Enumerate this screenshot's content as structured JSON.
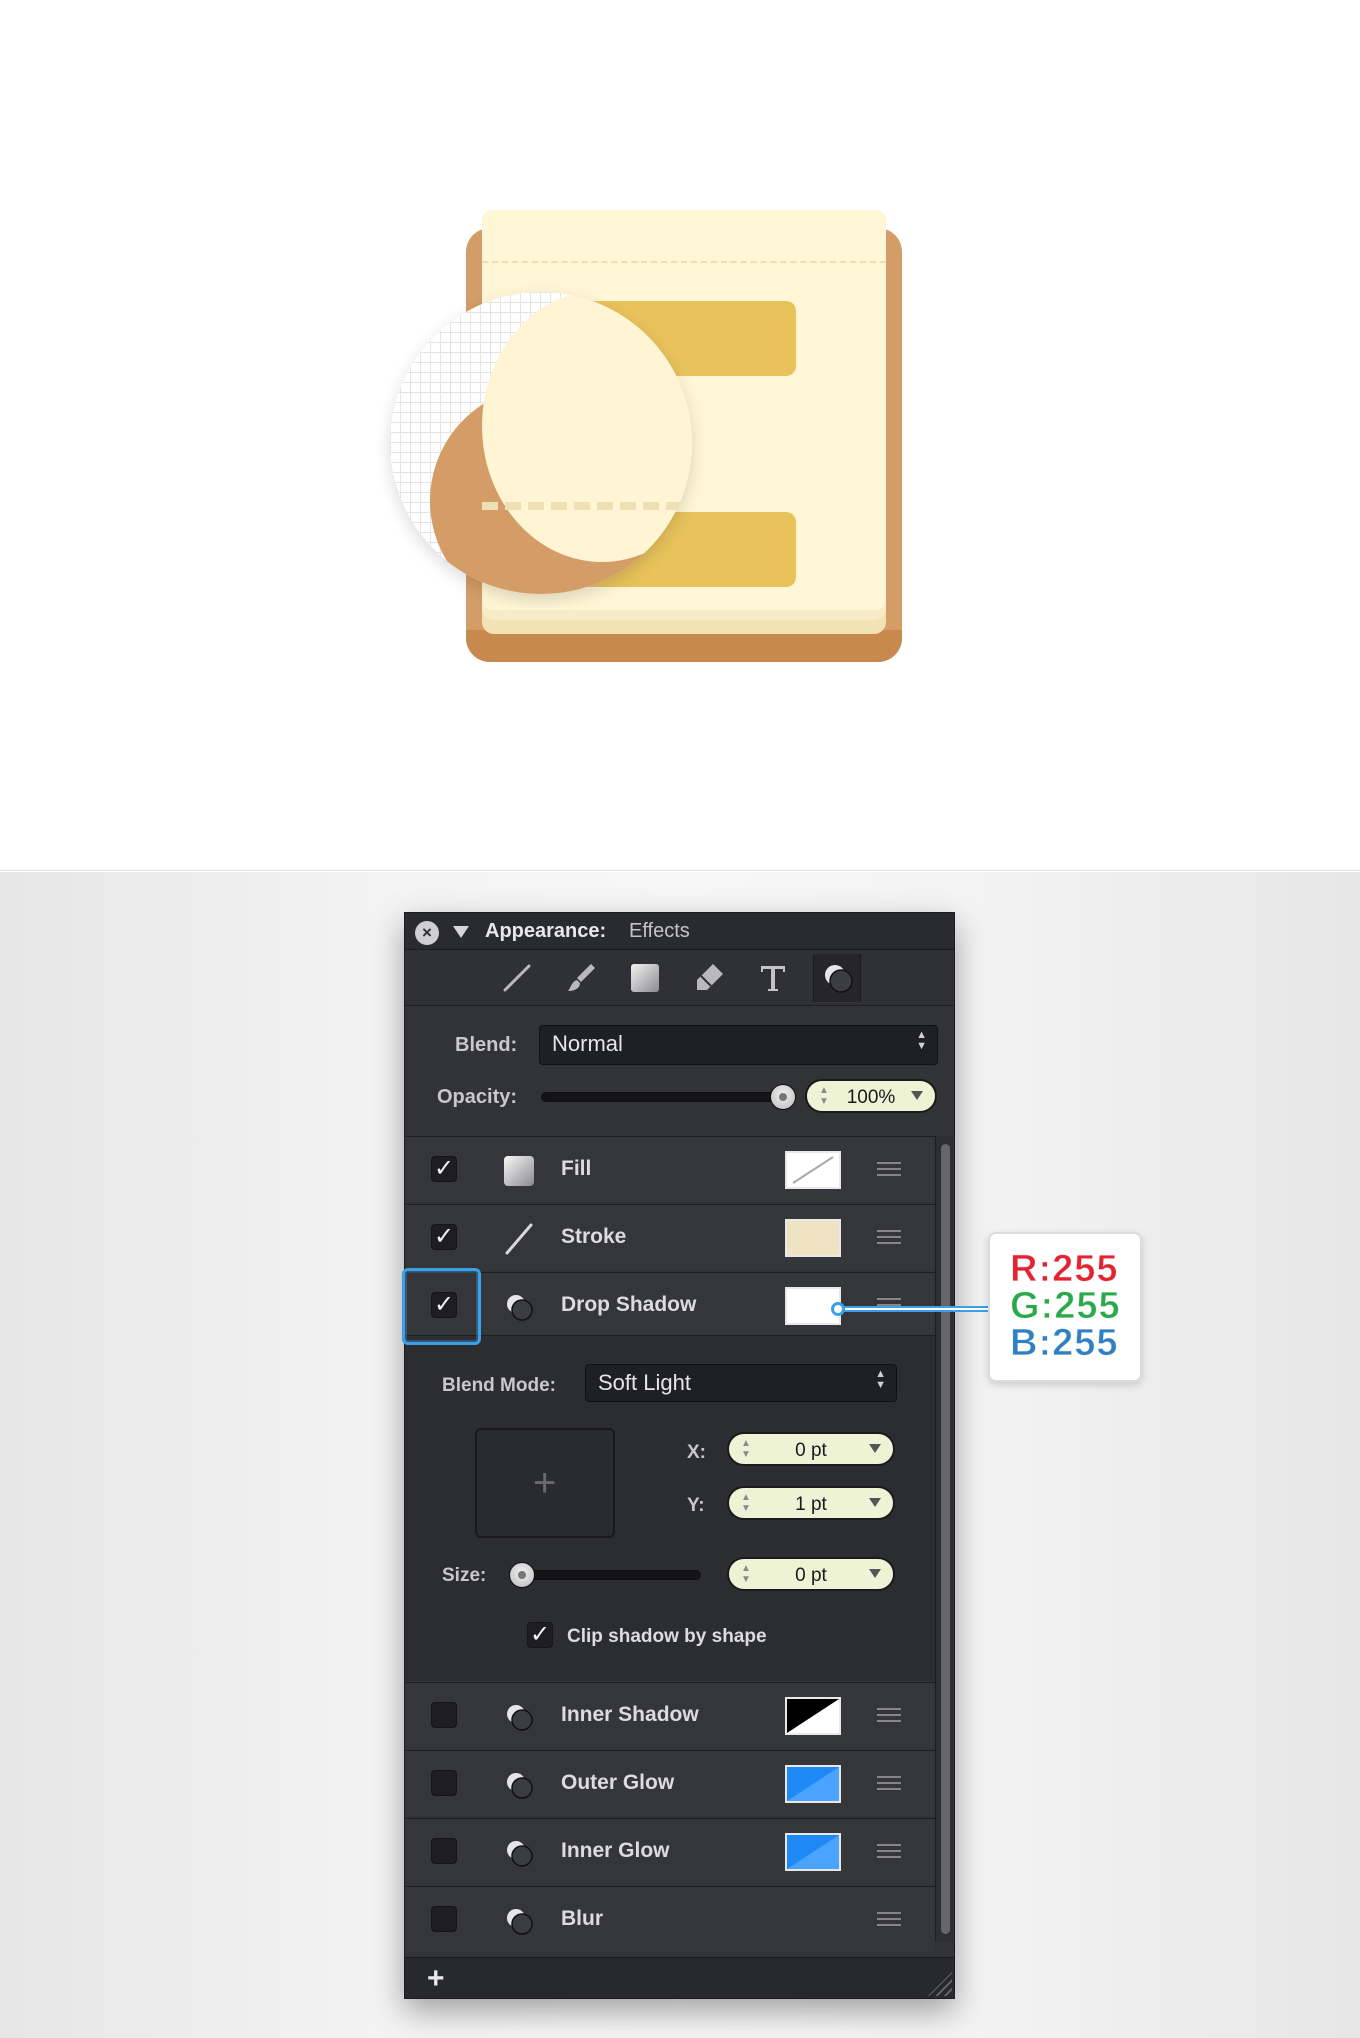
{
  "panel": {
    "title_label": "Appearance:",
    "title_value": "Effects",
    "tools": [
      {
        "icon": "line-tool-icon"
      },
      {
        "icon": "brush-tool-icon"
      },
      {
        "icon": "square-fill-icon"
      },
      {
        "icon": "eraser-tool-icon"
      },
      {
        "icon": "text-tool-icon"
      },
      {
        "icon": "effects-icon",
        "active": true
      }
    ],
    "blend_label": "Blend:",
    "blend_value": "Normal",
    "opacity_label": "Opacity:",
    "opacity_value": "100%",
    "opacity_level": 1.0,
    "effects": [
      {
        "label": "Fill",
        "checked": true,
        "icon": "fill-icon",
        "swatch": "none"
      },
      {
        "label": "Stroke",
        "checked": true,
        "icon": "stroke-icon",
        "swatch": "#f0e3c3"
      },
      {
        "label": "Drop Shadow",
        "checked": true,
        "icon": "shadow-icon",
        "swatch": "#ffffff"
      },
      {
        "label": "Inner Shadow",
        "checked": false,
        "icon": "shadow-icon",
        "swatch": "#000000"
      },
      {
        "label": "Outer Glow",
        "checked": false,
        "icon": "shadow-icon",
        "swatch": "#1e88f5"
      },
      {
        "label": "Inner Glow",
        "checked": false,
        "icon": "shadow-icon",
        "swatch": "#1e88f5"
      },
      {
        "label": "Blur",
        "checked": false,
        "icon": "shadow-icon",
        "swatch": null
      }
    ],
    "drop_shadow": {
      "blend_mode_label": "Blend Mode:",
      "blend_mode_value": "Soft Light",
      "x_label": "X:",
      "x_value": "0 pt",
      "y_label": "Y:",
      "y_value": "1 pt",
      "size_label": "Size:",
      "size_value": "0 pt",
      "size_level": 0,
      "clip_label": "Clip shadow by shape",
      "clip_checked": true
    },
    "add_label": "+"
  },
  "callout": {
    "r": "R:255",
    "g": "G:255",
    "b": "B:255"
  },
  "colors": {
    "accent": "#3ba0e8",
    "panel_bg": "#323337",
    "field_bg": "#eff3d6"
  }
}
